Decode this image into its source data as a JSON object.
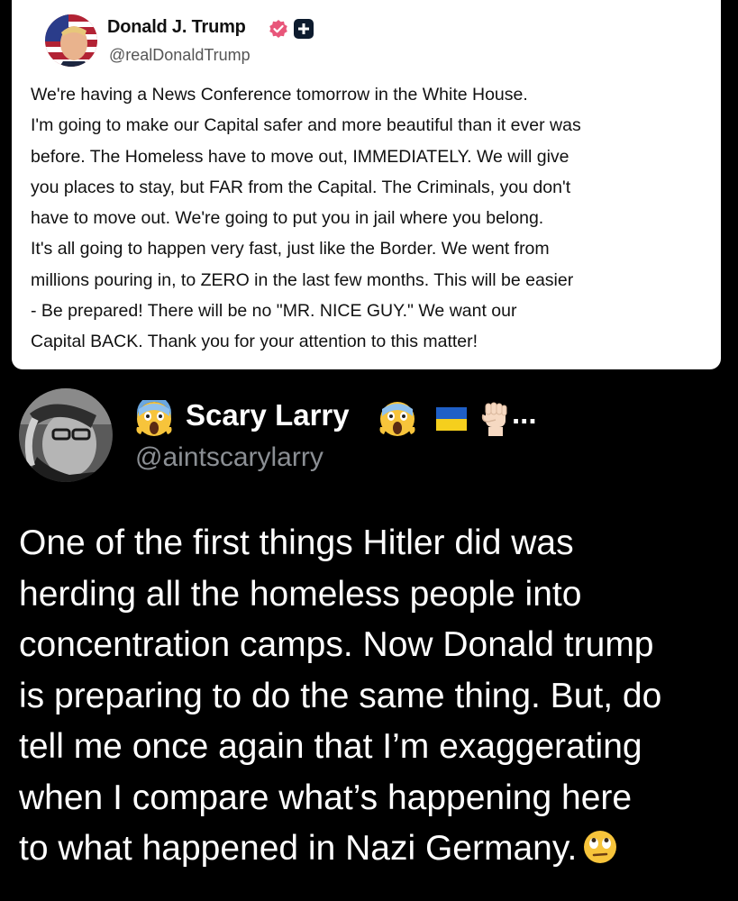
{
  "post": {
    "author_name": "Donald J. Trump",
    "author_handle": "@realDonaldTrump",
    "body_lines": [
      "We're having a News Conference tomorrow in the White House.",
      "I'm going to make our Capital safer and more beautiful than it ever was",
      "before. The Homeless have to move out, IMMEDIATELY. We will give",
      "you places to stay, but FAR from the Capital. The Criminals, you don't",
      "have to move out. We're going to put you in jail where you belong.",
      "It's all going to happen very fast, just like the Border. We went from",
      "millions pouring in, to ZERO in the  last few months. This will be easier",
      "- Be prepared! There will be no \"MR. NICE GUY.\" We want our",
      "Capital BACK. Thank you for your attention to this matter!"
    ],
    "badges": [
      "verified-badge-icon",
      "plus-badge-icon"
    ]
  },
  "reply": {
    "author_name": "Scary Larry",
    "author_handle": "@aintscarylarry",
    "name_decorations": [
      "scream-emoji",
      "scream-emoji",
      "ukraine-flag-emoji",
      "raised-fist-emoji"
    ],
    "name_overflow": "...",
    "body_lines": [
      "One of the first things Hitler did was",
      "herding all the homeless people into",
      "concentration camps. Now Donald trump",
      "is preparing to do the same thing. But, do",
      "tell me once again that I’m exaggerating",
      "when I compare what’s happening here",
      "to what happened in Nazi Germany."
    ],
    "trailing_emoji": "eye-roll-emoji"
  },
  "colors": {
    "background": "#000000",
    "card": "#ffffff",
    "verified": "#e8567a",
    "flag_blue": "#1f5fc6",
    "flag_yellow": "#f5cf1d",
    "handle_gray": "#8b8f94"
  }
}
